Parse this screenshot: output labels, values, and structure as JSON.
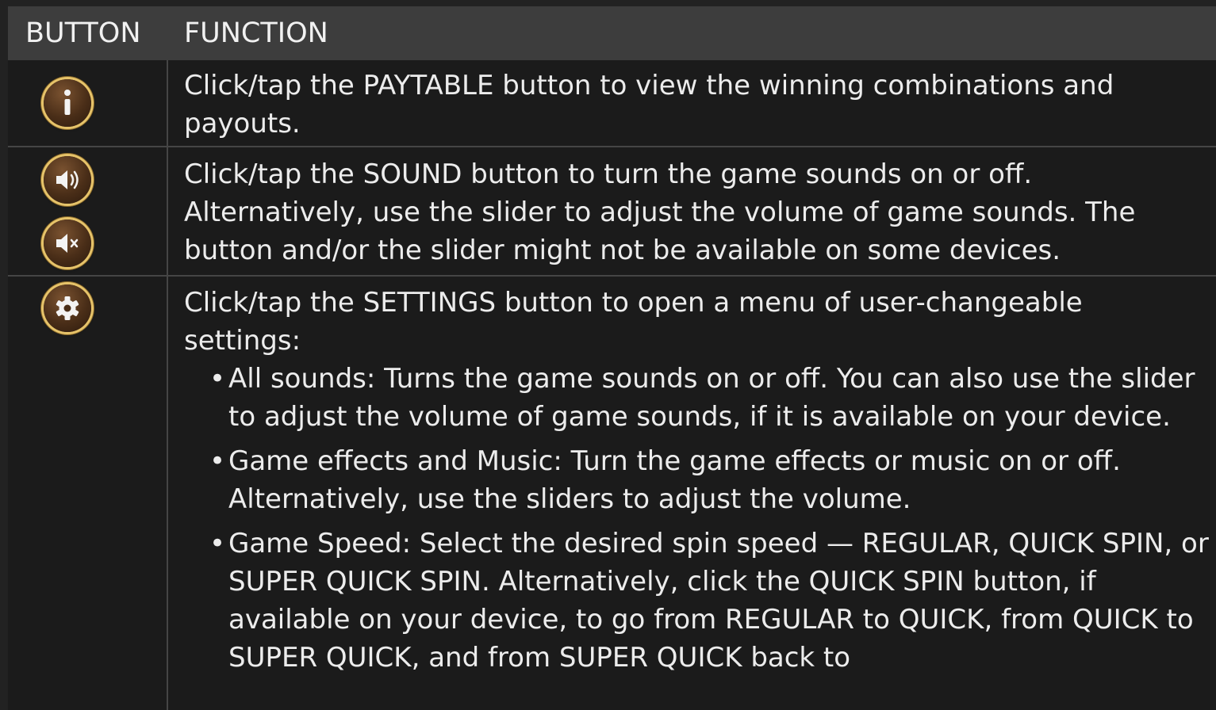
{
  "header": {
    "col_button": "BUTTON",
    "col_function": "FUNCTION"
  },
  "rows": {
    "paytable": {
      "icon": "info-icon",
      "text": "Click/tap the PAYTABLE button to view the winning combinations and payouts."
    },
    "sound": {
      "icons": [
        "sound-on-icon",
        "sound-off-icon"
      ],
      "text": "Click/tap the SOUND button to turn the game sounds on or off. Alternatively, use the slider to adjust the volume of game sounds. The button and/or the slider might not be available on some devices."
    },
    "settings": {
      "icon": "gear-icon",
      "text": "Click/tap the SETTINGS button to open a menu of user-changeable settings:",
      "bullets": [
        "All sounds: Turns the game sounds on or off. You can also use the slider to adjust the volume of game sounds, if it is available on your device.",
        "Game effects and Music: Turn the game effects or music on or off. Alternatively, use the sliders to adjust the volume.",
        "Game Speed: Select the desired spin speed — REGULAR, QUICK SPIN, or SUPER QUICK SPIN. Alternatively, click the QUICK SPIN button, if available on your device, to go from REGULAR to QUICK, from QUICK to SUPER QUICK, and from SUPER QUICK back to"
      ]
    }
  },
  "colors": {
    "header_bg": "#3d3d3d",
    "table_bg": "#1b1b1b",
    "icon_ring": "#e6c36a",
    "icon_fill": "#4a2e18"
  }
}
